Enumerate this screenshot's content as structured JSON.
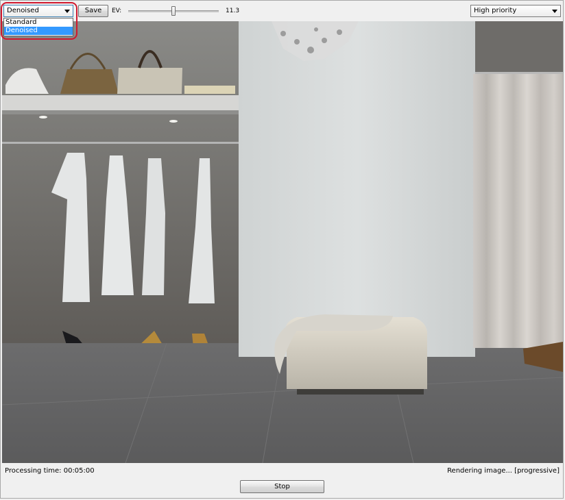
{
  "toolbar": {
    "mode_select": {
      "value": "Denoised"
    },
    "save_label": "Save",
    "ev_label": "EV:",
    "ev_value": "11.3",
    "ev_slider_level": 0.5,
    "priority_select": {
      "value": "High priority"
    }
  },
  "mode_dropdown": {
    "options": [
      "Standard",
      "Denoised"
    ],
    "selected": "Denoised"
  },
  "status": {
    "processing_time": "Processing time: 00:05:00",
    "render_state": "Rendering image... [progressive]"
  },
  "actions": {
    "stop_label": "Stop"
  },
  "colors": {
    "selection": "#3399ff",
    "highlight_ring": "#d0182e"
  }
}
